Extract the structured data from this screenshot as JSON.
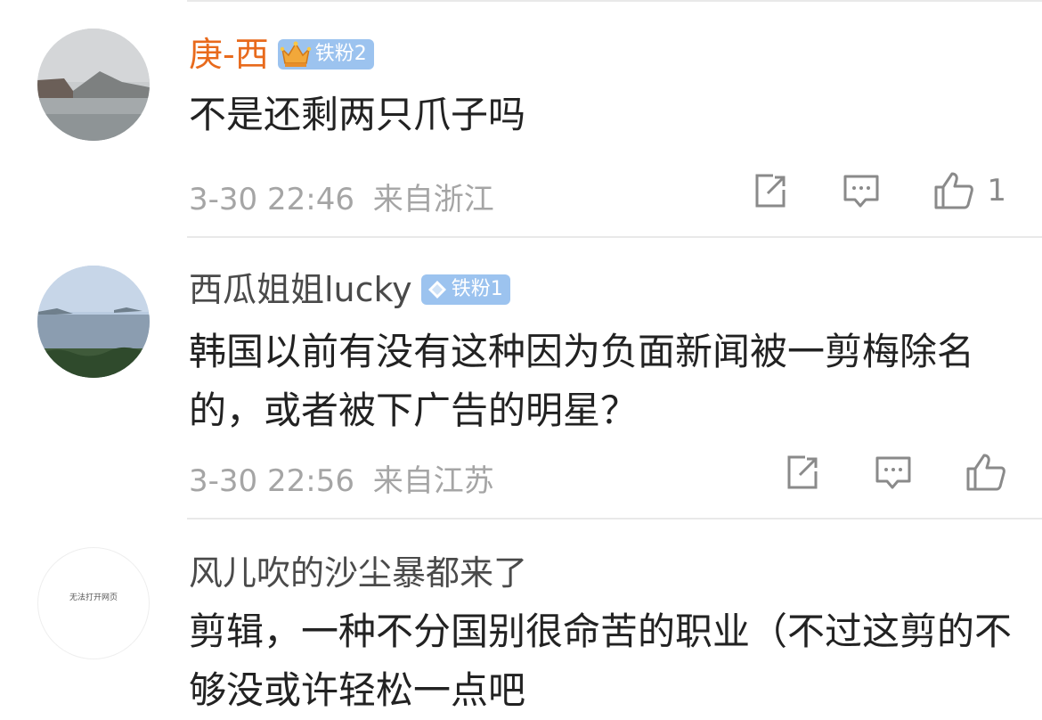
{
  "comments": [
    {
      "username": "庚-西",
      "badge": "铁粉2",
      "text": "不是还剩两只爪子吗",
      "time": "3-30 22:46",
      "location": "来自浙江",
      "like_count": "1",
      "icons": {
        "badge": "crown-icon",
        "share": "share-icon",
        "reply": "comment-icon",
        "like": "thumbs-up-icon"
      }
    },
    {
      "username": "西瓜姐姐lucky",
      "badge": "铁粉1",
      "text": "韩国以前有没有这种因为负面新闻被一剪梅除名的，或者被下广告的明星？",
      "time": "3-30 22:56",
      "location": "来自江苏",
      "like_count": "",
      "icons": {
        "badge": "diamond-icon",
        "share": "share-icon",
        "reply": "comment-icon",
        "like": "thumbs-up-icon"
      }
    },
    {
      "username": "风儿吹的沙尘暴都来了",
      "text": "剪辑，一种不分国别很命苦的职业（不过这剪的不够没或许轻松一点吧",
      "avatar_text": "无法打开网页",
      "icons": {}
    }
  ],
  "colors": {
    "vip_name": "#e86a1c",
    "badge_bg": "#9cc3ef",
    "meta_text": "#a5a5a5",
    "divider": "#e9e9e9"
  }
}
